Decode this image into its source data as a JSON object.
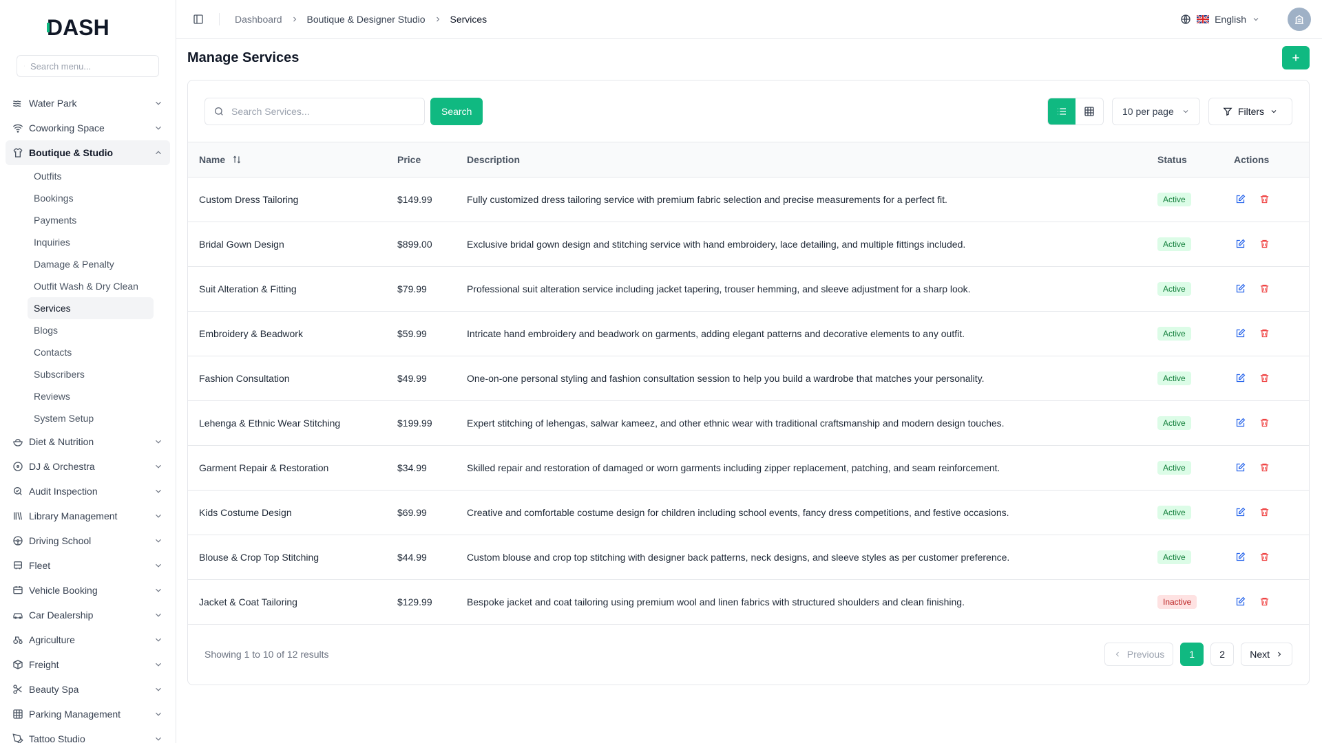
{
  "brand": {
    "logo_text": "DASH",
    "accent": "#10b981"
  },
  "sidebar": {
    "search_placeholder": "Search menu...",
    "items_before": [
      {
        "label": "Water Park",
        "icon": "waves-icon"
      },
      {
        "label": "Coworking Space",
        "icon": "wifi-icon"
      }
    ],
    "open_item": {
      "label": "Boutique & Studio",
      "icon": "shirt-icon"
    },
    "sub_items": [
      {
        "label": "Outfits"
      },
      {
        "label": "Bookings"
      },
      {
        "label": "Payments"
      },
      {
        "label": "Inquiries"
      },
      {
        "label": "Damage & Penalty"
      },
      {
        "label": "Outfit Wash & Dry Clean"
      },
      {
        "label": "Services"
      },
      {
        "label": "Blogs"
      },
      {
        "label": "Contacts"
      },
      {
        "label": "Subscribers"
      },
      {
        "label": "Reviews"
      },
      {
        "label": "System Setup"
      }
    ],
    "items_after": [
      {
        "label": "Diet & Nutrition",
        "icon": "salad-icon"
      },
      {
        "label": "DJ & Orchestra",
        "icon": "disc-icon"
      },
      {
        "label": "Audit Inspection",
        "icon": "search-check-icon"
      },
      {
        "label": "Library Management",
        "icon": "library-icon"
      },
      {
        "label": "Driving School",
        "icon": "steering-wheel-icon"
      },
      {
        "label": "Fleet",
        "icon": "bus-icon"
      },
      {
        "label": "Vehicle Booking",
        "icon": "calendar-car-icon"
      },
      {
        "label": "Car Dealership",
        "icon": "car-icon"
      },
      {
        "label": "Agriculture",
        "icon": "tractor-icon"
      },
      {
        "label": "Freight",
        "icon": "container-icon"
      },
      {
        "label": "Beauty Spa",
        "icon": "scissors-icon"
      },
      {
        "label": "Parking Management",
        "icon": "grid-icon"
      },
      {
        "label": "Tattoo Studio",
        "icon": "pen-tool-icon"
      }
    ]
  },
  "header": {
    "breadcrumbs": [
      "Dashboard",
      "Boutique & Designer Studio",
      "Services"
    ],
    "language": "English"
  },
  "page": {
    "title": "Manage Services",
    "search_placeholder": "Search Services...",
    "search_button": "Search",
    "per_page": "10 per page",
    "filters": "Filters"
  },
  "table": {
    "columns": {
      "name": "Name",
      "price": "Price",
      "description": "Description",
      "status": "Status",
      "actions": "Actions"
    },
    "rows": [
      {
        "name": "Custom Dress Tailoring",
        "price": "$149.99",
        "description": "Fully customized dress tailoring service with premium fabric selection and precise measurements for a perfect fit.",
        "status": "Active"
      },
      {
        "name": "Bridal Gown Design",
        "price": "$899.00",
        "description": "Exclusive bridal gown design and stitching service with hand embroidery, lace detailing, and multiple fittings included.",
        "status": "Active"
      },
      {
        "name": "Suit Alteration & Fitting",
        "price": "$79.99",
        "description": "Professional suit alteration service including jacket tapering, trouser hemming, and sleeve adjustment for a sharp look.",
        "status": "Active"
      },
      {
        "name": "Embroidery & Beadwork",
        "price": "$59.99",
        "description": "Intricate hand embroidery and beadwork on garments, adding elegant patterns and decorative elements to any outfit.",
        "status": "Active"
      },
      {
        "name": "Fashion Consultation",
        "price": "$49.99",
        "description": "One-on-one personal styling and fashion consultation session to help you build a wardrobe that matches your personality.",
        "status": "Active"
      },
      {
        "name": "Lehenga & Ethnic Wear Stitching",
        "price": "$199.99",
        "description": "Expert stitching of lehengas, salwar kameez, and other ethnic wear with traditional craftsmanship and modern design touches.",
        "status": "Active"
      },
      {
        "name": "Garment Repair & Restoration",
        "price": "$34.99",
        "description": "Skilled repair and restoration of damaged or worn garments including zipper replacement, patching, and seam reinforcement.",
        "status": "Active"
      },
      {
        "name": "Kids Costume Design",
        "price": "$69.99",
        "description": "Creative and comfortable costume design for children including school events, fancy dress competitions, and festive occasions.",
        "status": "Active"
      },
      {
        "name": "Blouse & Crop Top Stitching",
        "price": "$44.99",
        "description": "Custom blouse and crop top stitching with designer back patterns, neck designs, and sleeve styles as per customer preference.",
        "status": "Active"
      },
      {
        "name": "Jacket & Coat Tailoring",
        "price": "$129.99",
        "description": "Bespoke jacket and coat tailoring using premium wool and linen fabrics with structured shoulders and clean finishing.",
        "status": "Inactive"
      }
    ]
  },
  "pagination": {
    "showing": "Showing 1 to 10 of 12 results",
    "previous": "Previous",
    "next": "Next",
    "pages": [
      "1",
      "2"
    ]
  }
}
